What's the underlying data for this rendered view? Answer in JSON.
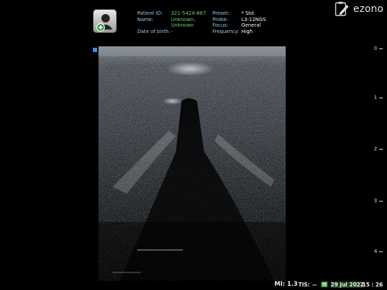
{
  "patient": {
    "id_label": "Patient ID:",
    "id_value": "321-5424-887",
    "name_label": "Name:",
    "name_line1": "Unknown,",
    "name_line2": "Unknown",
    "dob_label": "Date of birth:",
    "dob_value": "-"
  },
  "settings": {
    "preset_label": "Preset:",
    "preset_value": "* Std.",
    "probe_label": "Probe:",
    "probe_value": "L3-12NGS",
    "focus_label": "Focus:",
    "focus_value": "General",
    "frequency_label": "Frequency:",
    "frequency_value": "High"
  },
  "brand": {
    "logo": "ezono",
    "report_icon": "clipboard-pen-icon"
  },
  "patient_button_icon": "add-patient-icon",
  "depth_scale": {
    "ticks": [
      "0",
      "1",
      "2",
      "3",
      "4"
    ]
  },
  "status_bar": {
    "mi": "MI: 1.3",
    "tis_label": "TIS:",
    "tis_value": "--",
    "date": "29 Jul 2022",
    "time": "15 : 26"
  },
  "colors": {
    "label": "#9ecbe6",
    "value": "#6fd36f",
    "marker": "#3e8fe0"
  }
}
